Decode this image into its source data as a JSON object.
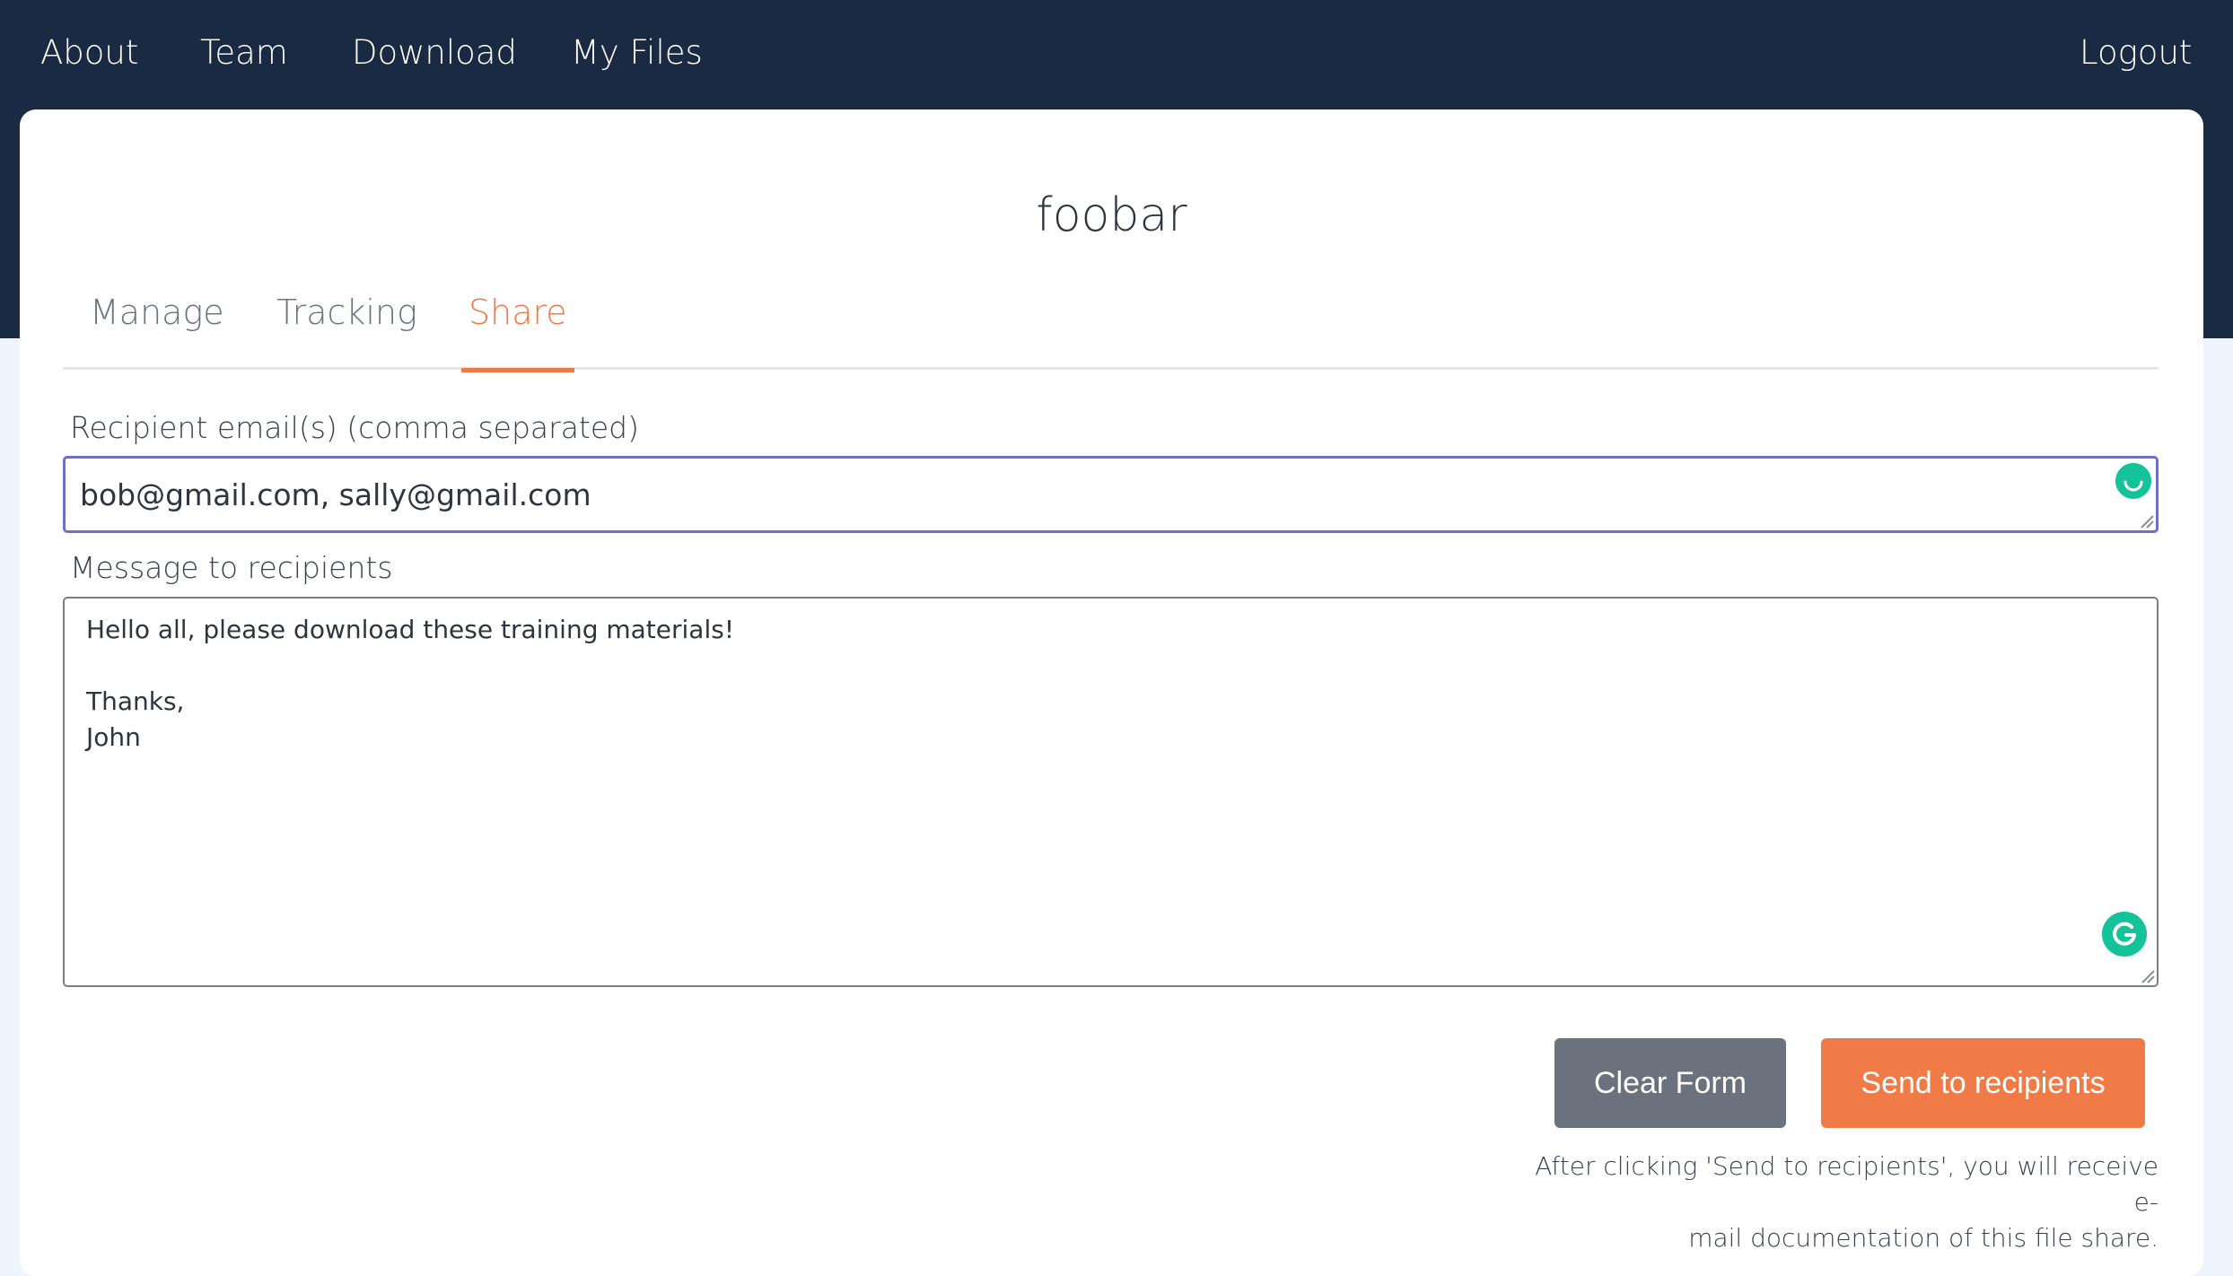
{
  "nav": {
    "items": [
      "About",
      "Team",
      "Download",
      "My Files"
    ],
    "logout": "Logout"
  },
  "page": {
    "title": "foobar",
    "tabs": [
      "Manage",
      "Tracking",
      "Share"
    ],
    "active_tab": "Share"
  },
  "form": {
    "email_label": "Recipient email(s) (comma separated)",
    "email_value": "bob@gmail.com, sally@gmail.com",
    "message_label": "Message to recipients",
    "message_lines": [
      "Hello all, please download these training materials!",
      "",
      "Thanks,",
      "John"
    ]
  },
  "buttons": {
    "clear": "Clear Form",
    "send": "Send to recipients"
  },
  "note": {
    "line1": "After clicking 'Send to recipients', you will receive e-",
    "line2": "mail documentation of this file share."
  },
  "colors": {
    "navbar": "#1b2a43",
    "accent": "#f07a46",
    "clear_button": "#6b717d",
    "grammarly": "#15c39a"
  }
}
